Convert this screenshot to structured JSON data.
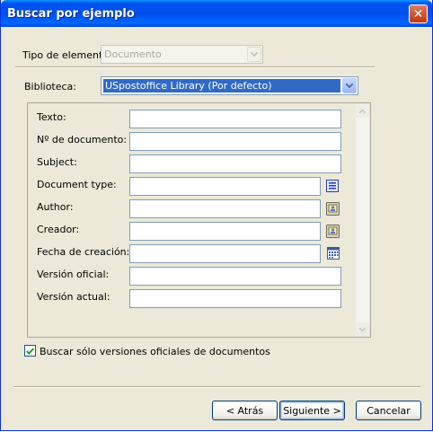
{
  "window": {
    "title": "Buscar por ejemplo"
  },
  "element_type": {
    "label": "Tipo de elemento:",
    "value": "Documento"
  },
  "library": {
    "label": "Biblioteca:",
    "value": "USpostoffice Library  (Por defecto)"
  },
  "fields": {
    "text": {
      "label": "Texto:",
      "value": ""
    },
    "doc_number": {
      "label": "Nº de documento:",
      "value": ""
    },
    "subject": {
      "label": "Subject:",
      "value": ""
    },
    "doc_type": {
      "label": "Document type:",
      "value": ""
    },
    "author": {
      "label": "Author:",
      "value": ""
    },
    "creator": {
      "label": "Creador:",
      "value": ""
    },
    "created": {
      "label": "Fecha de creación:",
      "value": ""
    },
    "official_version": {
      "label": "Versión oficial:",
      "value": ""
    },
    "current_version": {
      "label": "Versión actual:",
      "value": ""
    }
  },
  "search_official_only": {
    "label": "Buscar sólo versiones oficiales de documentos",
    "checked": true
  },
  "buttons": {
    "back": "< Atrás",
    "next": "Siguiente >",
    "cancel": "Cancelar"
  },
  "icons": {
    "close": "close-icon",
    "dropdown": "chevron-down-icon",
    "list_picker": "list-icon",
    "user_picker": "user-card-icon",
    "calendar": "calendar-icon",
    "scroll_up": "scroll-up-icon",
    "scroll_down": "scroll-down-icon",
    "check": "checkmark-icon"
  },
  "colors": {
    "titlebar": "#0053ee",
    "selection": "#316ac5",
    "dialog_bg": "#ece9d8"
  }
}
